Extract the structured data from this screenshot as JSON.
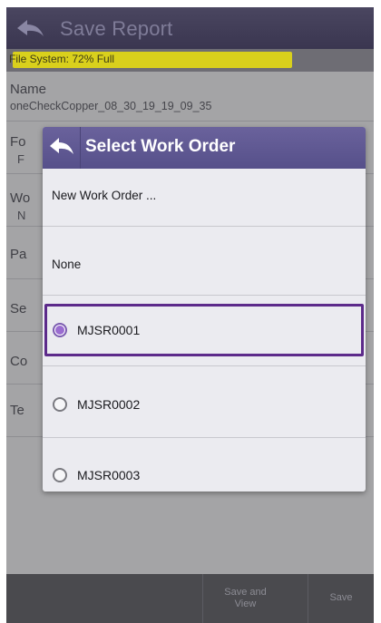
{
  "appbar": {
    "title": "Save Report",
    "back_icon": "back-arrow-icon"
  },
  "file_system": {
    "label": "File System: 72% Full",
    "percent_full": 72,
    "color": "#d9d01c"
  },
  "fields": [
    {
      "label": "Name",
      "value": "oneCheckCopper_08_30_19_19_09_35"
    },
    {
      "label": "Fo",
      "value": "F"
    },
    {
      "label": "Wo",
      "value": "N"
    },
    {
      "label": "Pa",
      "value": ""
    },
    {
      "label": "Se",
      "value": ""
    },
    {
      "label": "Co",
      "value": ""
    },
    {
      "label": "Te",
      "value": ""
    }
  ],
  "bottom_bar": {
    "save_and_view_label": "Save and View",
    "save_label": "Save"
  },
  "dialog": {
    "title": "Select Work Order",
    "back_icon": "back-arrow-icon",
    "options": [
      {
        "label": "New Work Order ...",
        "type": "action"
      },
      {
        "label": "None",
        "type": "action"
      },
      {
        "label": "MJSR0001",
        "type": "radio",
        "selected": true
      },
      {
        "label": "MJSR0002",
        "type": "radio",
        "selected": false
      },
      {
        "label": "MJSR0003",
        "type": "radio",
        "selected": false
      }
    ],
    "accent_color": "#5c2a8a"
  }
}
